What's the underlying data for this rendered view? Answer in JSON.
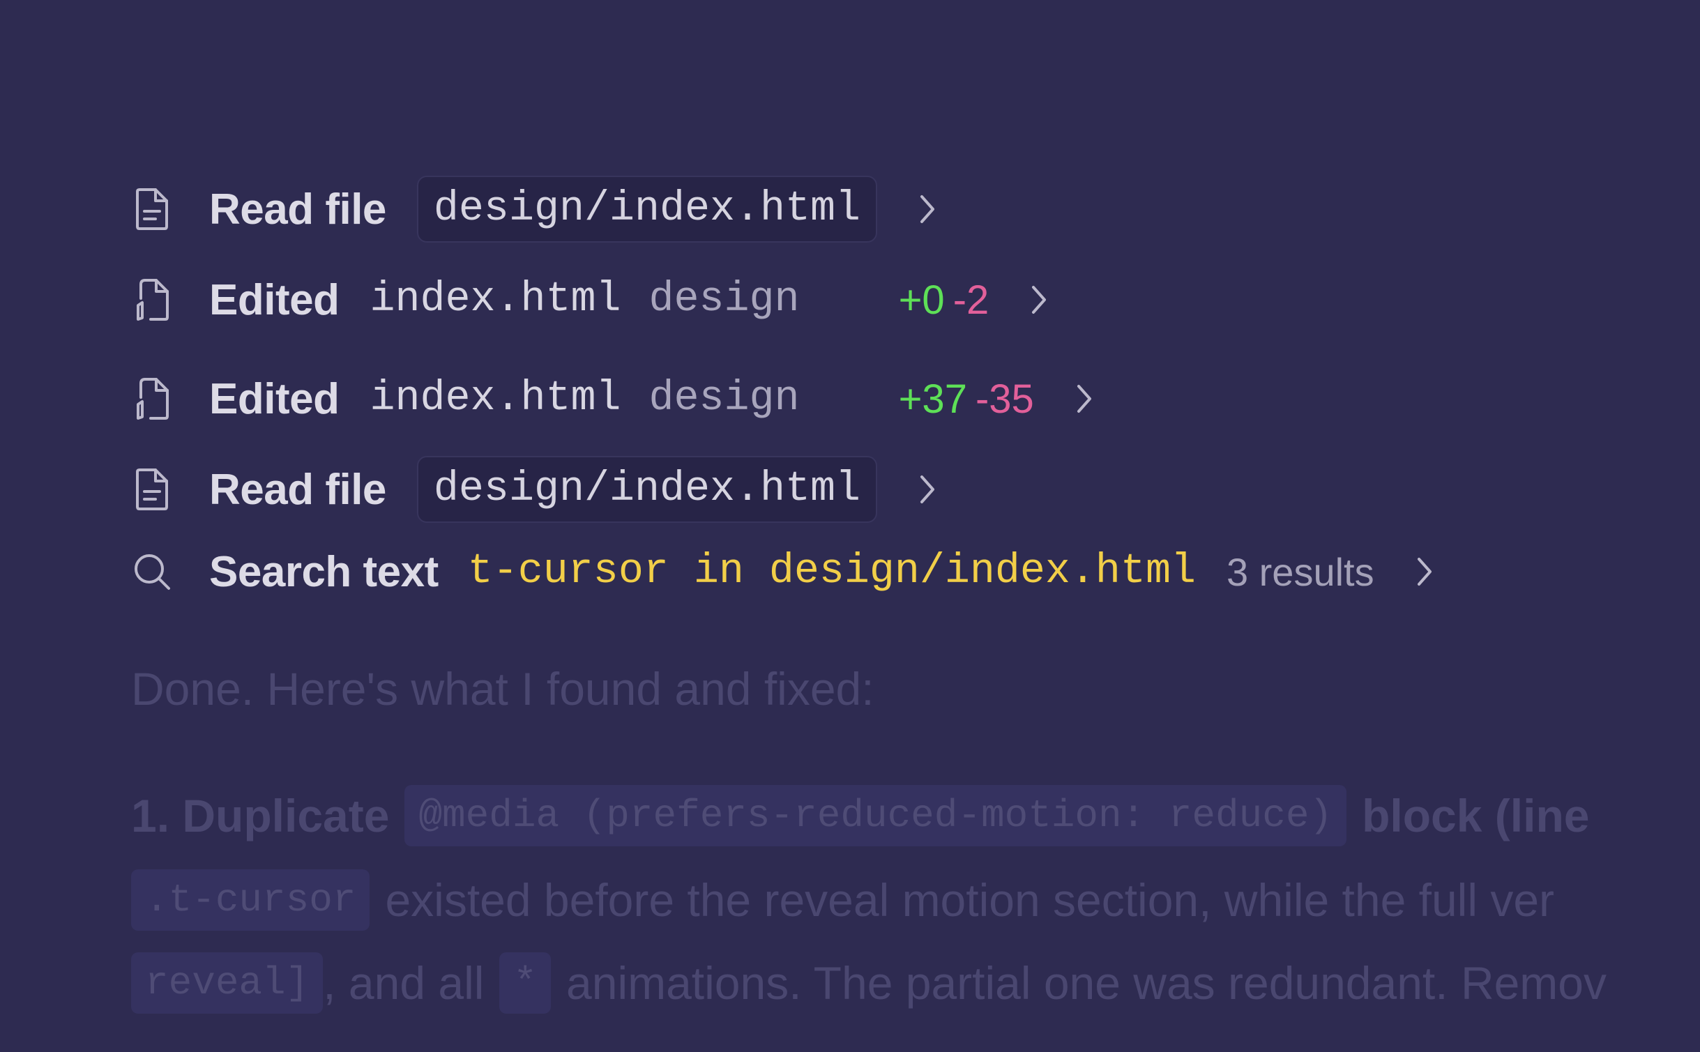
{
  "steps": [
    {
      "icon": "file-text-icon",
      "verb": "Read file",
      "path": "design/index.html"
    },
    {
      "icon": "file-edit-icon",
      "verb": "Edited",
      "file": "index.html",
      "dir": "design",
      "additions": "+0",
      "deletions": "-2"
    },
    {
      "icon": "file-edit-icon",
      "verb": "Edited",
      "file": "index.html",
      "dir": "design",
      "additions": "+37",
      "deletions": "-35"
    },
    {
      "icon": "file-text-icon",
      "verb": "Read file",
      "path": "design/index.html"
    },
    {
      "icon": "search-icon",
      "verb": "Search text",
      "query": "t-cursor in design/index.html",
      "count": "3 results"
    }
  ],
  "summary": "Done. Here's what I found and fixed:",
  "item1": {
    "prefix": "1. Duplicate",
    "code": "@media (prefers-reduced-motion: reduce)",
    "suffix": "block (line"
  },
  "line2": {
    "code": ".t-cursor",
    "text": "existed before the reveal motion section, while the full ver"
  },
  "line3": {
    "code_a": "reveal]",
    "text_a": ", and all",
    "code_b": "*",
    "text_b": "animations. The partial one was redundant. Remov"
  },
  "colors": {
    "background": "#2e2b51",
    "additions": "#5ee057",
    "deletions": "#e2609a",
    "query": "#f2cf48"
  }
}
